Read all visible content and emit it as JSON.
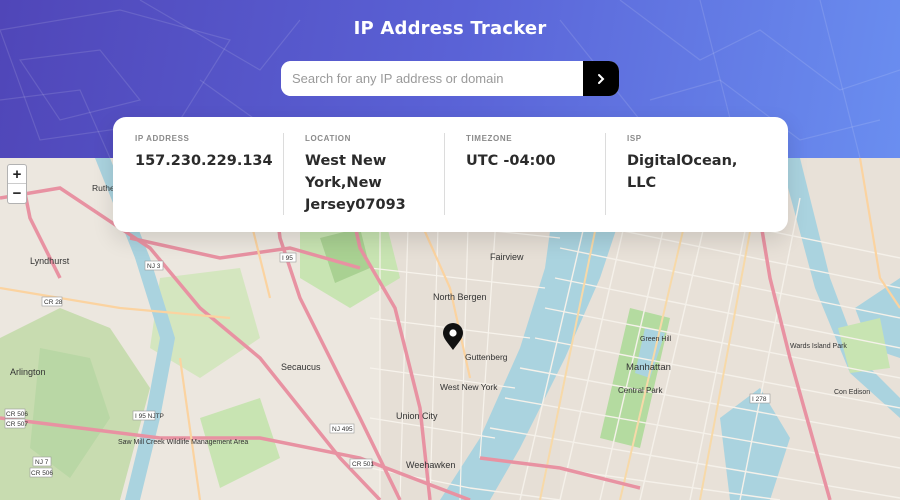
{
  "app": {
    "title": "IP Address Tracker"
  },
  "search": {
    "placeholder": "Search for any IP address or domain",
    "value": "",
    "submit_icon": "chevron-right-icon"
  },
  "info": [
    {
      "label": "IP ADDRESS",
      "value": "157.230.229.134"
    },
    {
      "label": "LOCATION",
      "value": "West New York,New Jersey07093"
    },
    {
      "label": "TIMEZONE",
      "value": "UTC -04:00"
    },
    {
      "label": "ISP",
      "value": "DigitalOcean, LLC"
    }
  ],
  "map": {
    "zoom_in": "+",
    "zoom_out": "−",
    "marker_icon": "location-pin-icon",
    "places": {
      "fairview": "Fairview",
      "north_bergen": "North Bergen",
      "guttenberg": "Guttenberg",
      "west_new_york": "West New York",
      "secaucus": "Secaucus",
      "union_city": "Union City",
      "weehawken": "Weehawken",
      "manhattan": "Manhattan",
      "central_park": "Central Park",
      "lyndhurst": "Lyndhurst",
      "arlington": "Arlington",
      "rutherford": "Ruthe",
      "sawmill": "Saw Mill Creek Wildlife Management Area",
      "con_edison": "Con Edison",
      "green_hill": "Green Hill",
      "ward_island": "Wards Island Park"
    },
    "shields": [
      "NJ 3",
      "I 95",
      "CR 28",
      "NJ 495",
      "CR 501",
      "I 95 NJTP",
      "I 278",
      "CR 506",
      "CR 507",
      "NJ 7",
      "CR 506"
    ]
  },
  "colors": {
    "header_start": "#5046b8",
    "header_end": "#6a8ef0",
    "water": "#aad3df",
    "park": "#c8e4b2",
    "road": "#e892a2"
  }
}
